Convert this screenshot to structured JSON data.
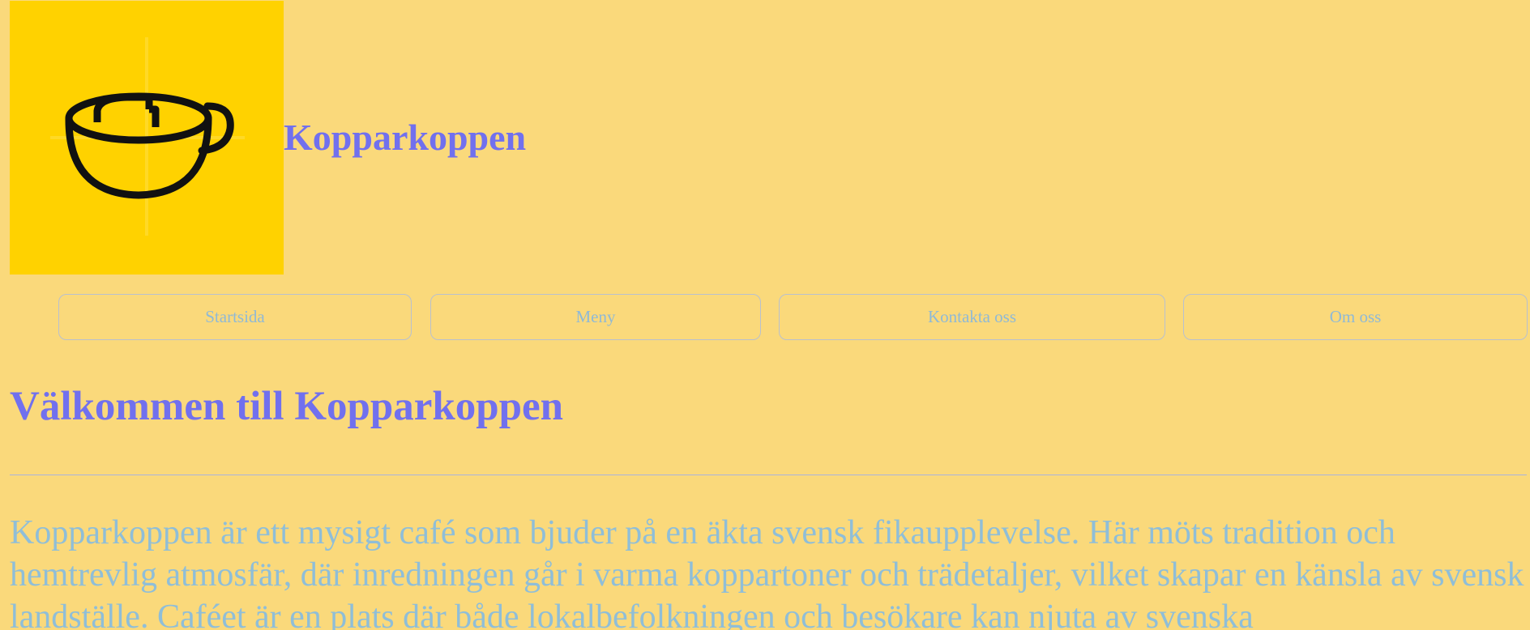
{
  "header": {
    "site_title": "Kopparkoppen",
    "logo_icon": "coffee-cup-icon",
    "logo_bg_color": "#ffd200"
  },
  "nav": {
    "items": [
      {
        "label": "Startsida"
      },
      {
        "label": "Meny"
      },
      {
        "label": "Kontakta oss"
      },
      {
        "label": "Om oss"
      }
    ]
  },
  "main": {
    "heading": "Välkommen till Kopparkoppen",
    "intro": "Kopparkoppen är ett mysigt café som bjuder på en äkta svensk fikaupplevelse. Här möts tradition och hemtrevlig atmosfär, där inredningen går i varma koppartoner och trädetaljer, vilket skapar en känsla av svensk landställe. Caféet är en plats där både lokalbefolkningen och besökare kan njuta av svenska"
  },
  "colors": {
    "page_background": "#fad97b",
    "title_color": "#7170ee",
    "text_color": "#8fbed8"
  }
}
